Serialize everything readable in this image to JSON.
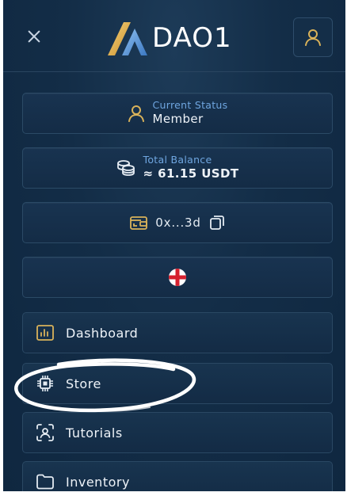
{
  "header": {
    "logo_text": "DAO1",
    "close_icon": "close-icon",
    "user_icon": "user-icon"
  },
  "status": {
    "label": "Current Status",
    "value": "Member",
    "icon": "user-icon"
  },
  "balance": {
    "label": "Total Balance",
    "value": "≈ 61.15 USDT",
    "icon": "coins-icon"
  },
  "wallet": {
    "address": "0x...3d",
    "wallet_icon": "wallet-icon",
    "copy_icon": "copy-icon"
  },
  "language": {
    "flag_icon": "england-flag-icon"
  },
  "nav": {
    "items": [
      {
        "label": "Dashboard",
        "icon": "chart-icon"
      },
      {
        "label": "Store",
        "icon": "chip-icon"
      },
      {
        "label": "Tutorials",
        "icon": "scan-user-icon"
      },
      {
        "label": "Inventory",
        "icon": "folder-icon"
      }
    ]
  },
  "colors": {
    "background": "#132d47",
    "gold_accent": "#d9b25a",
    "blue_label": "#6fa6e0",
    "text": "#eef3f8"
  }
}
